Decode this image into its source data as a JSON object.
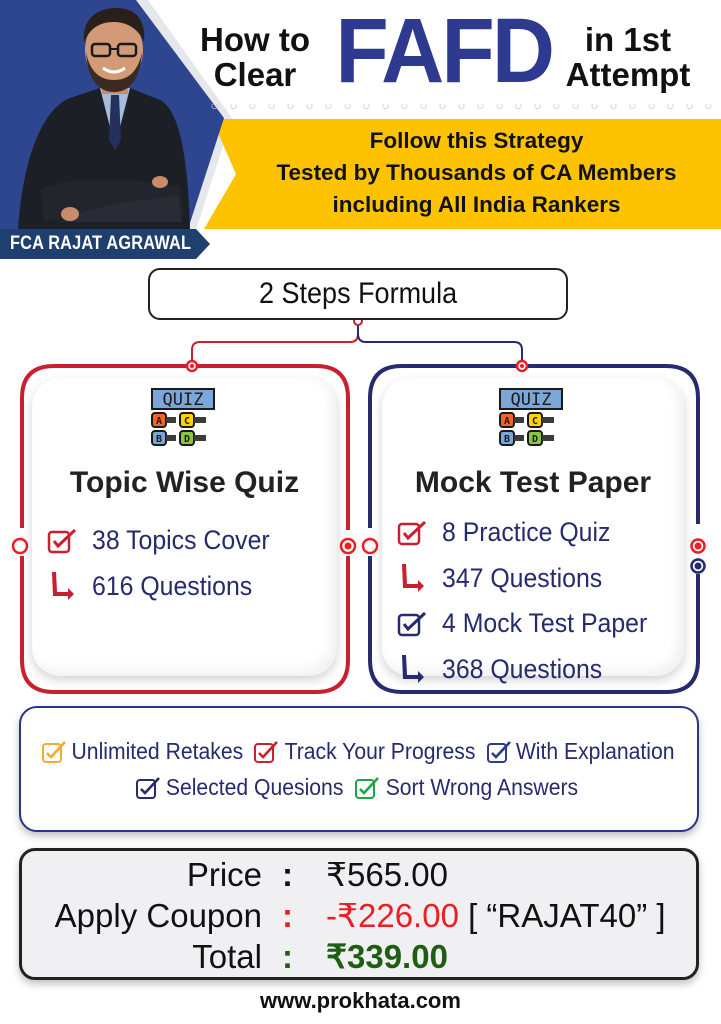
{
  "header": {
    "title_left_line1": "How to",
    "title_left_line2": "Clear",
    "title_big": "FAFD",
    "title_right_line1": "in 1st",
    "title_right_line2": "Attempt",
    "tagline_line1": "Follow this Strategy",
    "tagline_line2": "Tested by Thousands of CA Members",
    "tagline_line3": "including All India Rankers",
    "presenter_name": "FCA RAJAT AGRAWAL"
  },
  "formula": {
    "title": "2 Steps Formula"
  },
  "cards": [
    {
      "title": "Topic Wise Quiz",
      "icon": "quiz-abcd-icon",
      "icon_text": "QUIZ",
      "items": [
        {
          "icon": "checkbox-icon",
          "text": "38 Topics Cover"
        },
        {
          "icon": "arrow-return-icon",
          "text": "616 Questions"
        }
      ]
    },
    {
      "title": "Mock Test Paper",
      "icon": "quiz-abcd-icon",
      "icon_text": "QUIZ",
      "items": [
        {
          "icon": "checkbox-icon",
          "text": "8 Practice Quiz"
        },
        {
          "icon": "arrow-return-icon",
          "text": "347 Questions"
        },
        {
          "icon": "checkbox-icon",
          "text": "4 Mock Test Paper"
        },
        {
          "icon": "arrow-return-icon",
          "text": "368 Questions"
        }
      ]
    }
  ],
  "benefits": [
    {
      "text": "Unlimited Retakes",
      "color": "#f7a833"
    },
    {
      "text": "Track Your Progress",
      "color": "#c8202f"
    },
    {
      "text": "With Explanation",
      "color": "#2e3a8f"
    },
    {
      "text": "Selected Quesions",
      "color": "#262a6e"
    },
    {
      "text": "Sort Wrong Answers",
      "color": "#1fa34a"
    }
  ],
  "pricing": {
    "price_label": "Price",
    "price_value": "₹565.00",
    "coupon_label": "Apply Coupon",
    "coupon_discount": "-₹226.00",
    "coupon_code": "[ “RAJAT40” ]",
    "total_label": "Total",
    "total_value": "₹339.00",
    "separator": ":"
  },
  "footer": {
    "website": "www.prokhata.com"
  },
  "colors": {
    "brand_blue": "#2e3a8f",
    "navy": "#262a6e",
    "accent_yellow": "#fdc300",
    "accent_red": "#c8202f",
    "discount_red": "#ee1c24",
    "total_green": "#1e5e10"
  }
}
